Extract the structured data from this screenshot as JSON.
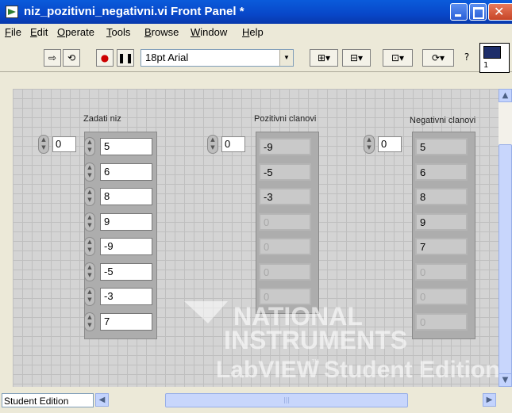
{
  "window": {
    "title": "niz_pozitivni_negativni.vi Front Panel *"
  },
  "menubar": {
    "items": [
      {
        "label": "File",
        "underline": "F"
      },
      {
        "label": "Edit",
        "underline": "E"
      },
      {
        "label": "Operate",
        "underline": "O"
      },
      {
        "label": "Tools",
        "underline": "T"
      },
      {
        "label": "Browse",
        "underline": "B"
      },
      {
        "label": "Window",
        "underline": "W"
      },
      {
        "label": "Help",
        "underline": "H"
      }
    ]
  },
  "toolbar": {
    "font_selector": "18pt Arial",
    "connector_number": "1"
  },
  "panel": {
    "arrays": [
      {
        "label": "Zadati niz",
        "index": "0",
        "kind": "control",
        "values": [
          "5",
          "6",
          "8",
          "9",
          "-9",
          "-5",
          "-3",
          "7"
        ],
        "dimmed_from": 8
      },
      {
        "label": "Pozitivni clanovi",
        "index": "0",
        "kind": "indicator",
        "values": [
          "-9",
          "-5",
          "-3",
          "0",
          "0",
          "0",
          "0"
        ],
        "dimmed_from": 3
      },
      {
        "label": "Negativni clanovi",
        "index": "0",
        "kind": "indicator",
        "values": [
          "5",
          "6",
          "8",
          "9",
          "7",
          "0",
          "0",
          "0"
        ],
        "dimmed_from": 5
      }
    ],
    "watermark": {
      "line1": "NATIONAL",
      "line2": "INSTRUMENTS",
      "line3": "LabVIEW",
      "tm": "™",
      "line4": "Student Edition"
    }
  },
  "statusbar": {
    "edition_label": "Student Edition"
  },
  "colors": {
    "titlebar": "#0A5BDB",
    "panel_bg": "#D4D4D4",
    "grid": "#BFBFBF"
  }
}
